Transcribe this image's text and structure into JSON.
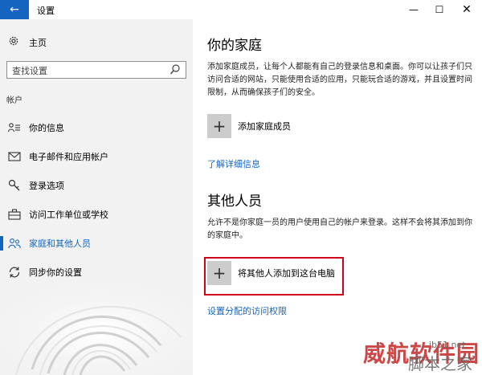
{
  "titlebar": {
    "back_glyph": "←",
    "title": "设置",
    "minimize_glyph": "—",
    "maximize_glyph": "☐",
    "close_glyph": "✕"
  },
  "sidebar": {
    "home_label": "主页",
    "search_placeholder": "查找设置",
    "section_label": "帐户",
    "items": [
      {
        "label": "你的信息",
        "icon": "person-card-icon"
      },
      {
        "label": "电子邮件和应用帐户",
        "icon": "email-icon"
      },
      {
        "label": "登录选项",
        "icon": "key-icon"
      },
      {
        "label": "访问工作单位或学校",
        "icon": "briefcase-icon"
      },
      {
        "label": "家庭和其他人员",
        "icon": "people-icon",
        "active": true
      },
      {
        "label": "同步你的设置",
        "icon": "sync-icon"
      }
    ]
  },
  "main": {
    "family": {
      "heading": "你的家庭",
      "description": "添加家庭成员，让每个人都能有自己的登录信息和桌面。你可以让孩子们只访问合适的网站，只能使用合适的应用，只能玩合适的游戏，并且设置时间限制，从而确保孩子们的安全。",
      "add_label": "添加家庭成员",
      "more_link": "了解详细信息"
    },
    "others": {
      "heading": "其他人员",
      "description": "允许不是你家庭一员的用户使用自己的帐户来登录。这样不会将其添加到你的家庭中。",
      "add_label": "将其他人添加到这台电脑",
      "access_link": "设置分配的访问权限"
    },
    "plus_glyph": "+"
  },
  "watermark": {
    "brand": "威航软件园",
    "site": "jb51.net",
    "brand2": "脚本之家"
  },
  "colors": {
    "accent": "#1565c0",
    "highlight_border": "#d0021b",
    "sidebar_bg": "#f2f2f2"
  }
}
